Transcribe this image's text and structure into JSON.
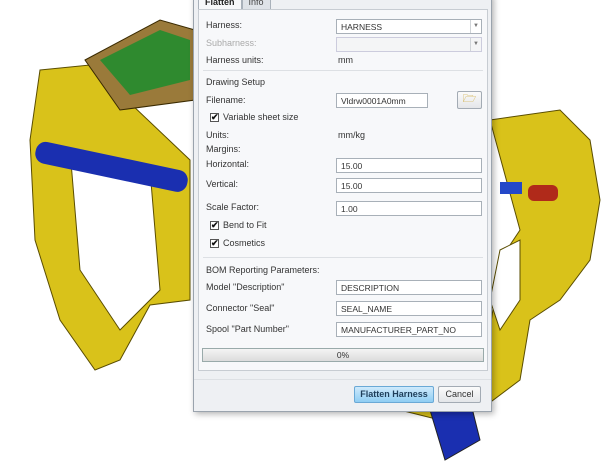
{
  "tabs": [
    "Flatten",
    "Info"
  ],
  "harness": {
    "label": "Harness:",
    "value": "HARNESS"
  },
  "subharness": {
    "label": "Subharness:",
    "value": ""
  },
  "harness_units": {
    "label": "Harness units:",
    "value": "mm"
  },
  "drawing_setup": {
    "title": "Drawing Setup",
    "filename_label": "Filename:",
    "filename": "Vldrw0001A0mm",
    "variable_sheet_size": "Variable sheet size",
    "variable_sheet_checked": true,
    "units_label": "Units:",
    "units": "mm/kg",
    "margins_label": "Margins:",
    "horizontal_label": "Horizontal:",
    "horizontal": "15.00",
    "vertical_label": "Vertical:",
    "vertical": "15.00",
    "scale_label": "Scale Factor:",
    "scale": "1.00",
    "bend_to_fit": "Bend to Fit",
    "bend_checked": true,
    "cosmetics": "Cosmetics",
    "cosmetics_checked": true
  },
  "bom": {
    "title": "BOM Reporting Parameters:",
    "model_label": "Model \"Description\"",
    "model": "DESCRIPTION",
    "connector_label": "Connector \"Seal\"",
    "connector": "SEAL_NAME",
    "spool_label": "Spool \"Part Number\"",
    "spool": "MANUFACTURER_PART_NO"
  },
  "progress": {
    "text": "0%",
    "value": 0
  },
  "buttons": {
    "flatten": "Flatten Harness",
    "cancel": "Cancel"
  },
  "check": "✔",
  "colors": {
    "part": "#d9c21a",
    "accent": "#8fcdf3"
  }
}
